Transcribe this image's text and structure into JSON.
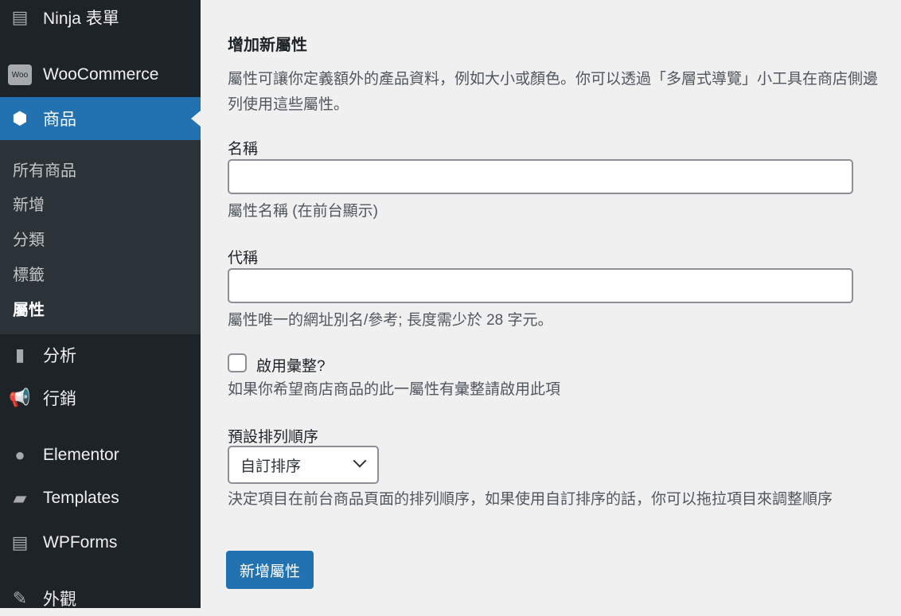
{
  "sidebar": {
    "items": [
      {
        "label": "Ninja 表單",
        "icon": "form-icon"
      },
      {
        "label": "WooCommerce",
        "icon": "woo-icon"
      },
      {
        "label": "商品",
        "icon": "box-icon",
        "active": true
      },
      {
        "label": "分析",
        "icon": "bar-chart-icon"
      },
      {
        "label": "行銷",
        "icon": "megaphone-icon"
      },
      {
        "label": "Elementor",
        "icon": "elementor-icon"
      },
      {
        "label": "Templates",
        "icon": "folder-icon"
      },
      {
        "label": "WPForms",
        "icon": "wpforms-icon"
      },
      {
        "label": "外觀",
        "icon": "paintbrush-icon"
      }
    ],
    "submenu": [
      "所有商品",
      "新增",
      "分類",
      "標籤",
      "屬性"
    ]
  },
  "form": {
    "title": "增加新屬性",
    "intro": "屬性可讓你定義額外的產品資料，例如大小或顏色。你可以透過「多層式導覽」小工具在商店側邊列使用這些屬性。",
    "name_label": "名稱",
    "name_value": "",
    "name_help": "屬性名稱 (在前台顯示)",
    "slug_label": "代稱",
    "slug_value": "",
    "slug_help": "屬性唯一的網址別名/參考; 長度需少於 28 字元。",
    "archive_label": "啟用彙整?",
    "archive_checked": false,
    "archive_help": "如果你希望商店商品的此一屬性有彙整請啟用此項",
    "order_label": "預設排列順序",
    "order_value": "自訂排序",
    "order_help": "決定項目在前台商品頁面的排列順序，如果使用自訂排序的話，你可以拖拉項目來調整順序",
    "submit": "新增屬性"
  },
  "colors": {
    "accent": "#2271b1",
    "sidebar": "#1d2327"
  }
}
